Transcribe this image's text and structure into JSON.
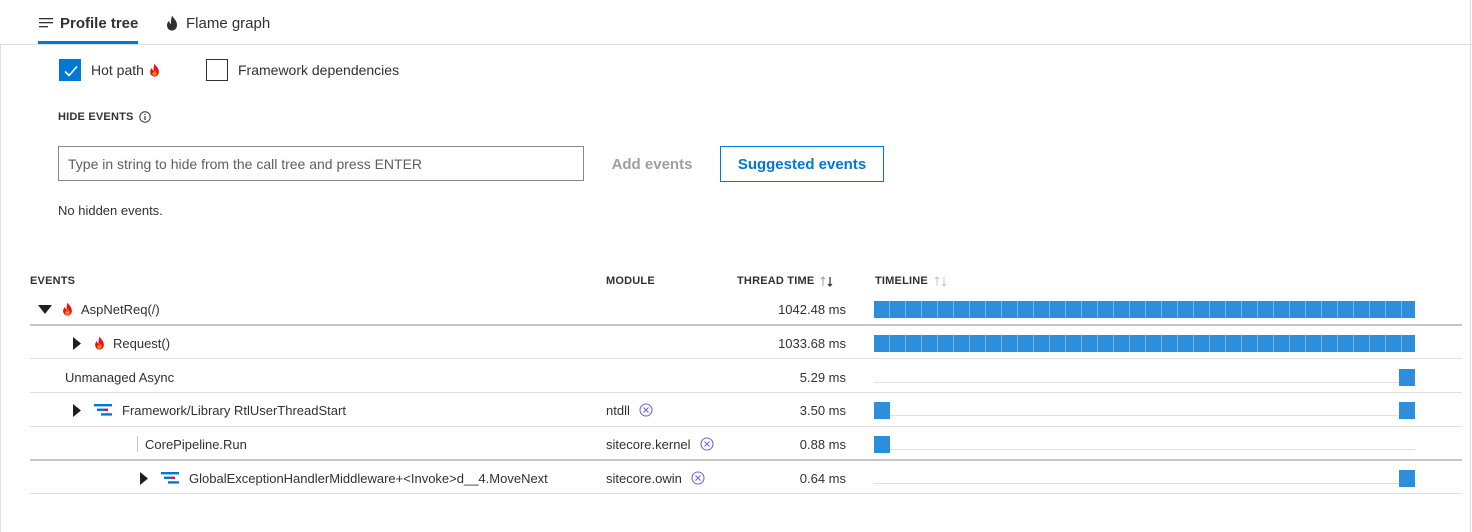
{
  "tabs": [
    {
      "label": "Profile tree",
      "icon": "list-icon",
      "active": true
    },
    {
      "label": "Flame graph",
      "icon": "flame-icon",
      "active": false
    }
  ],
  "options": {
    "hot_path": {
      "label": "Hot path",
      "checked": true
    },
    "framework_deps": {
      "label": "Framework dependencies",
      "checked": false
    }
  },
  "hide_events": {
    "title": "HIDE EVENTS",
    "input_placeholder": "Type in string to hide from the call tree and press ENTER",
    "input_value": "",
    "add_button": "Add events",
    "suggested_button": "Suggested events",
    "status": "No hidden events."
  },
  "table": {
    "columns": {
      "events": "EVENTS",
      "module": "MODULE",
      "thread_time": "THREAD TIME",
      "timeline": "TIMELINE"
    },
    "rows": [
      {
        "name": "AspNetReq(/)",
        "module": "",
        "time": "1042.48 ms",
        "depth": 0,
        "caret": "expanded",
        "icon": "flame-icon",
        "timeline_start": 0.0,
        "timeline_end": 1.0
      },
      {
        "name": "Request()",
        "module": "",
        "time": "1033.68 ms",
        "depth": 1,
        "caret": "collapsed",
        "icon": "flame-icon",
        "timeline_start": 0.0,
        "timeline_end": 1.0
      },
      {
        "name": "Unmanaged Async",
        "module": "",
        "time": "5.29 ms",
        "depth": 0,
        "caret": "none",
        "icon": "",
        "timeline_start": 0.97,
        "timeline_end": 1.0
      },
      {
        "name": "Framework/Library RtlUserThreadStart",
        "module": "ntdll",
        "time": "3.50 ms",
        "depth": 1,
        "caret": "collapsed",
        "icon": "stack-icon",
        "timeline_start": 0.0,
        "timeline_end": 1.0
      },
      {
        "name": "CorePipeline.Run",
        "module": "sitecore.kernel",
        "time": "0.88 ms",
        "depth": 2,
        "caret": "none",
        "icon": "",
        "timeline_start": 0.0,
        "timeline_end": 0.03
      },
      {
        "name": "GlobalExceptionHandlerMiddleware+<Invoke>d__4.MoveNext",
        "module": "sitecore.owin",
        "time": "0.64 ms",
        "depth": 3,
        "caret": "collapsed",
        "icon": "stack-icon",
        "timeline_start": 0.97,
        "timeline_end": 1.0
      }
    ]
  },
  "colors": {
    "accent": "#0078d4",
    "flame": "#e81123",
    "timeline_bar": "#2d8fdc"
  }
}
